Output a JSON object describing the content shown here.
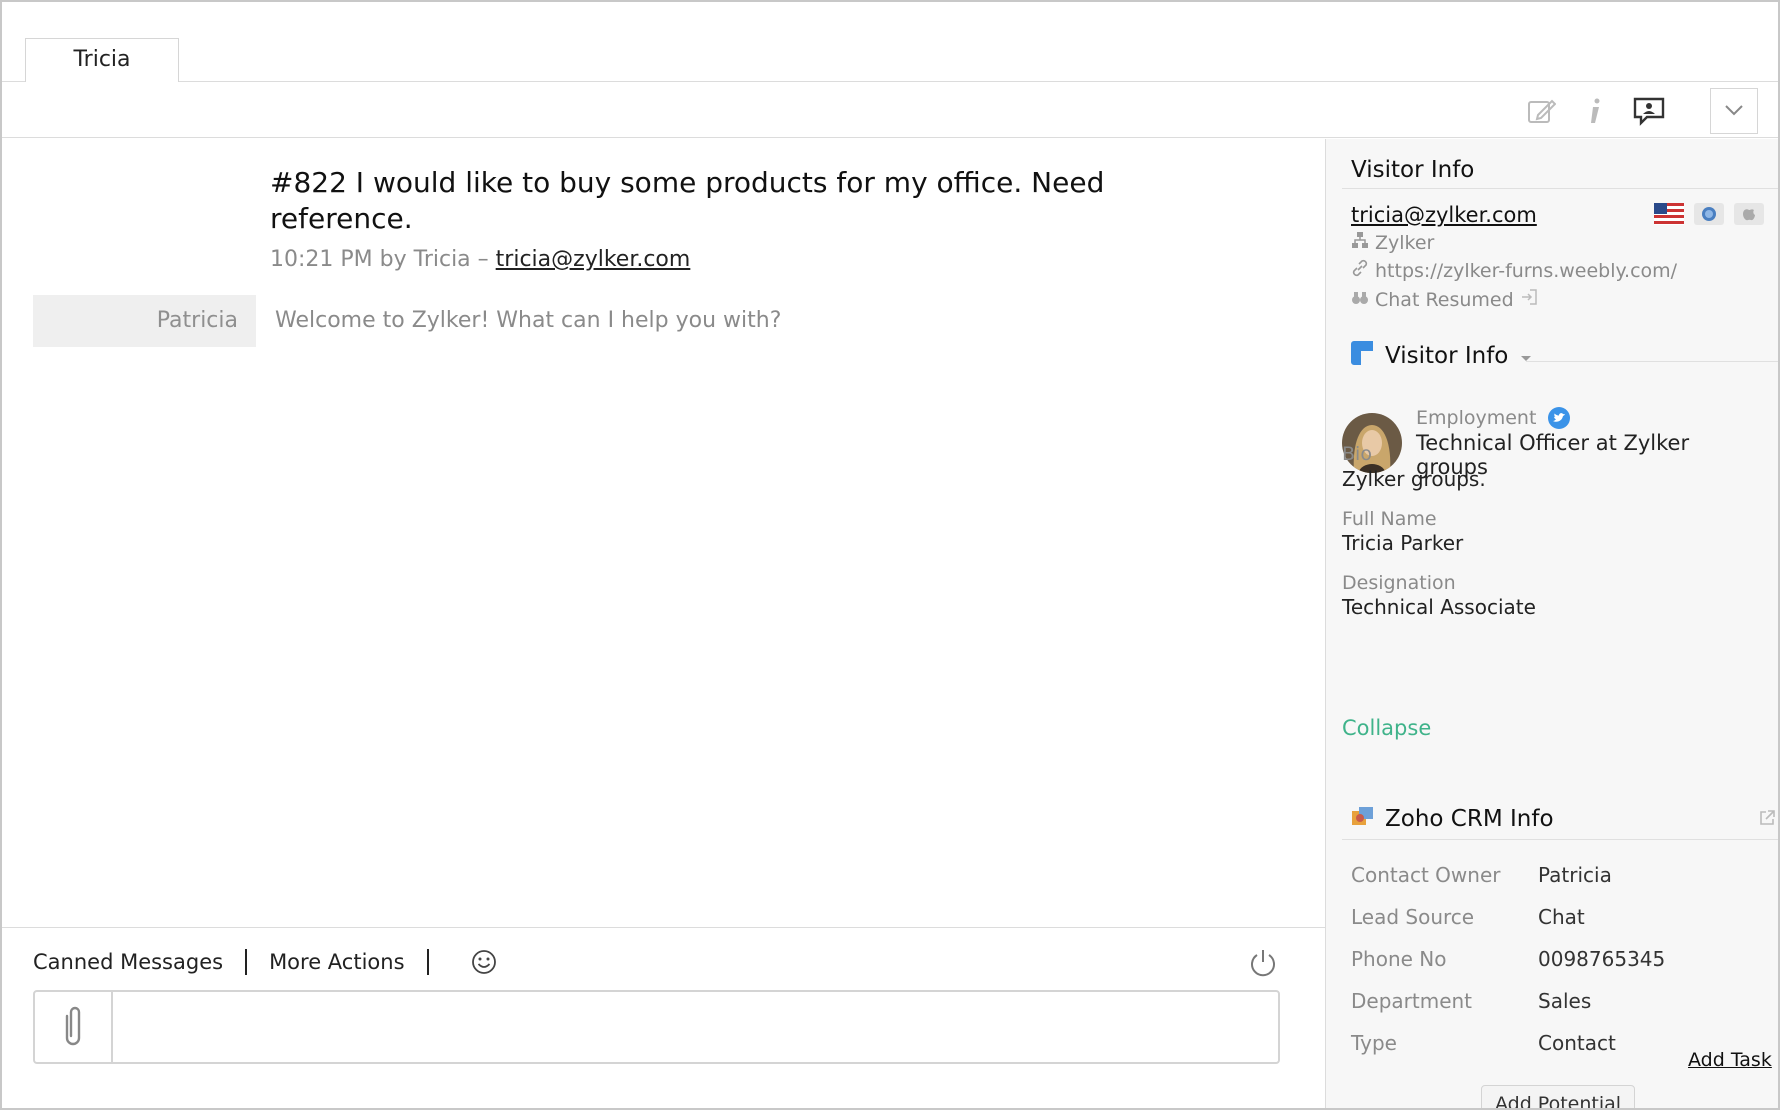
{
  "tab": {
    "label": "Tricia"
  },
  "toolbar": {
    "icons": [
      "edit-icon",
      "info-icon",
      "chat-bubble-icon",
      "chevron-down-icon"
    ]
  },
  "thread": {
    "title": "#822 I would like to buy some products for my office. Need reference.",
    "time_by": "10:21 PM by Tricia –",
    "email": "tricia@zylker.com"
  },
  "messages": [
    {
      "author": "Patricia",
      "text": "Welcome to Zylker! What can I help you with?"
    }
  ],
  "composer": {
    "canned_label": "Canned Messages",
    "more_actions_label": "More Actions",
    "input_value": ""
  },
  "visitor_info": {
    "heading": "Visitor Info",
    "email": "tricia@zylker.com",
    "company": "Zylker",
    "url": "https://zylker-furns.weebly.com/",
    "status": "Chat Resumed"
  },
  "visitor_details": {
    "heading": "Visitor Info",
    "employment_label": "Employment",
    "employment_value": "Technical Officer at Zylker groups",
    "bio_label": "Bio",
    "bio_value": "Zylker groups.",
    "fullname_label": "Full Name",
    "fullname_value": "Tricia Parker",
    "designation_label": "Designation",
    "designation_value": "Technical Associate",
    "collapse_label": "Collapse"
  },
  "crm": {
    "heading": "Zoho CRM Info",
    "rows": [
      {
        "key": "Contact Owner",
        "value": "Patricia"
      },
      {
        "key": "Lead Source",
        "value": "Chat"
      },
      {
        "key": "Phone No",
        "value": "0098765345"
      },
      {
        "key": "Department",
        "value": "Sales"
      },
      {
        "key": "Type",
        "value": "Contact"
      }
    ],
    "add_task_label": "Add Task",
    "add_potential_label": "Add Potential"
  },
  "colors": {
    "collapse_link": "#3fb38a",
    "twitter": "#3b93e8",
    "panel_bg": "#f7f7f7"
  }
}
